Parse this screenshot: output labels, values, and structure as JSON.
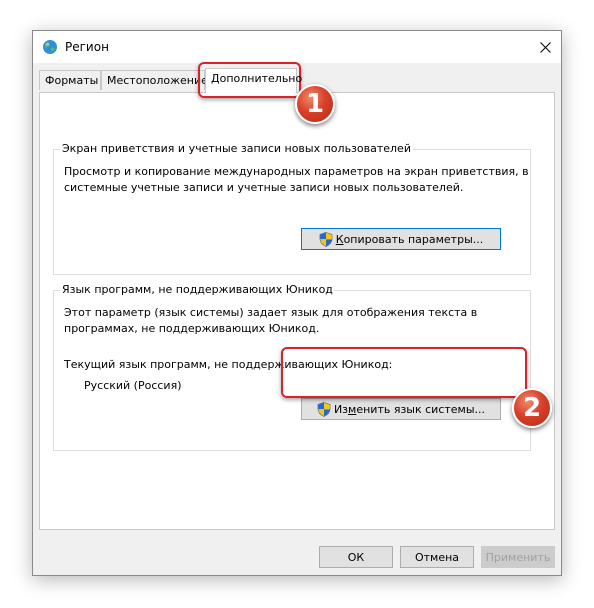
{
  "window": {
    "title": "Регион",
    "icon": "globe-region-icon",
    "close_glyph": "✕"
  },
  "tabs": [
    {
      "label": "Форматы",
      "active": false
    },
    {
      "label": "Местоположение",
      "active": false
    },
    {
      "label": "Дополнительно",
      "active": true
    }
  ],
  "welcome_group": {
    "label": "Экран приветствия и учетные записи новых пользователей",
    "description_line1": "Просмотр и копирование международных параметров на экран приветствия, в",
    "description_line2": "системные учетные записи и учетные записи новых пользователей.",
    "button_label_underlined": "К",
    "button_label_rest": "опировать параметры..."
  },
  "unicode_group": {
    "label": "Язык программ, не поддерживающих Юникод",
    "description_line1": "Этот параметр (язык системы) задает язык для отображения текста в",
    "description_line2": "программах, не поддерживающих Юникод.",
    "current_label": "Текущий язык программ, не поддерживающих Юникод:",
    "current_value": "Русский (Россия)",
    "button_label_pre": "Из",
    "button_label_underlined": "м",
    "button_label_rest": "енить язык системы..."
  },
  "footer": {
    "ok_label": "ОК",
    "cancel_label": "Отмена",
    "apply_label": "Применить"
  },
  "annotations": {
    "badge1": "1",
    "badge2": "2",
    "highlight_color": "#d8232a"
  }
}
